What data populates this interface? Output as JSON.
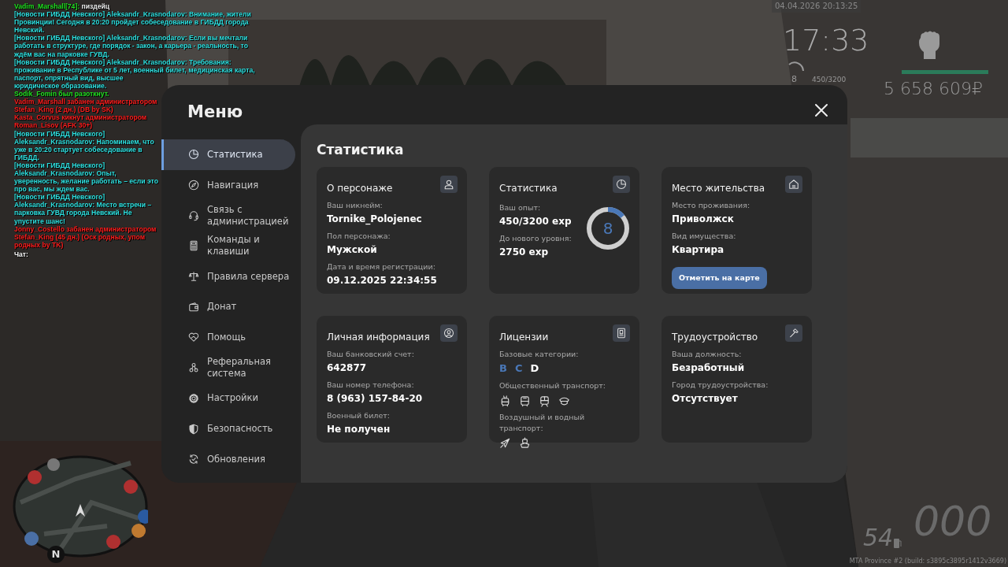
{
  "chat": [
    {
      "kind": "player",
      "name": "Vadim_Marshall[74]:",
      "text": "пиздейц"
    },
    {
      "kind": "news",
      "text": "[Новости ГИБДД Невского] Aleksandr_Krasnodarov: Внимание, жители Провинции! Сегодня в 20:20 пройдет собеседование в ГИБДД города Невский."
    },
    {
      "kind": "news",
      "text": "[Новости ГИБДД Невского] Aleksandr_Krasnodarov: Если вы мечтали работать в структуре, где порядок - закон, а карьера - реальность, то ждём вас на парковке ГУВД."
    },
    {
      "kind": "news",
      "text": "[Новости ГИБДД Невского] Aleksandr_Krasnodarov: Требования: проживание в Республике от 5 лет, военный билет, медицинская карта, паспорт, опрятный вид, высшее юридическое образование."
    },
    {
      "kind": "system",
      "text": "Sodik_Fomin был разоткнут."
    },
    {
      "kind": "ban",
      "text": "Vadim_Marshall забанен администратором Stefan_King (2 дн.) (DB by SK)"
    },
    {
      "kind": "ban",
      "text": "Kasta_Corvus кикнут администратором Roman_Lisov (AFK 30+)"
    },
    {
      "kind": "news",
      "text": "[Новости ГИБДД Невского] Aleksandr_Krasnodarov: Напоминаем, что уже в 20:20 стартует собеседование в ГИБДД."
    },
    {
      "kind": "news",
      "text": "[Новости ГИБДД Невского] Aleksandr_Krasnodarov: Опыт, уверенность, желание работать – если это про вас, мы ждем вас."
    },
    {
      "kind": "news",
      "text": "[Новости ГИБДД Невского] Aleksandr_Krasnodarov: Место встречи – парковка ГУВД города Невский. Не упустите шанс!"
    },
    {
      "kind": "ban",
      "text": "Jonny_Costello забанен администратором Stefan_King (45 дн.) (Оск родных, упом родных by TK)"
    }
  ],
  "chat_prompt": "Чат:",
  "hud": {
    "date": "04.04.2026 20:13:25",
    "time": "17:33",
    "player_level": "8",
    "exp": "450/3200",
    "health": {
      "level": 1
    },
    "money": "5 658 609₽",
    "compass": "N",
    "speed": "54",
    "odometer": "000",
    "build": "MTA Province #2 (build: s3895c3895r1412v3669)"
  },
  "menu": {
    "title": "Меню",
    "items": [
      {
        "label": "Статистика",
        "selected": true
      },
      {
        "label": "Навигация",
        "selected": false
      },
      {
        "label": "Связь с администрацией",
        "selected": false
      },
      {
        "label": "Команды и клавиши",
        "selected": false
      },
      {
        "label": "Правила сервера",
        "selected": false
      },
      {
        "label": "Донат",
        "selected": false
      },
      {
        "label": "Помощь",
        "selected": false
      },
      {
        "label": "Реферальная система",
        "selected": false
      },
      {
        "label": "Настройки",
        "selected": false
      },
      {
        "label": "Безопасность",
        "selected": false
      },
      {
        "label": "Обновления",
        "selected": false
      }
    ],
    "content_title": "Статистика",
    "cards": [
      {
        "kind": "fields",
        "title": "О персонаже",
        "fields": [
          {
            "label": "Ваш никнейм:",
            "value": "Tornike_Polojenec"
          },
          {
            "label": "Пол персонажа:",
            "value": "Мужской"
          },
          {
            "label": "Дата и время регистрации:",
            "value": "09.12.2025 22:34:55"
          }
        ]
      },
      {
        "kind": "stats",
        "title": "Статистика",
        "fields": [
          {
            "label": "Ваш опыт:",
            "value": "450/3200 exp"
          },
          {
            "label": "До нового уровня:",
            "value": "2750 exp"
          }
        ],
        "ring": {
          "level": 0.14,
          "label": "8"
        }
      },
      {
        "kind": "fields",
        "title": "Место жительства",
        "fields": [
          {
            "label": "Место проживания:",
            "value": "Приволжск"
          },
          {
            "label": "Вид имущества:",
            "value": "Квартира"
          }
        ],
        "button": "Отметить на карте"
      },
      {
        "kind": "fields",
        "title": "Личная информация",
        "fields": [
          {
            "label": "Ваш банковский счет:",
            "value": "642877"
          },
          {
            "label": "Ваш номер телефона:",
            "value": "8 (963) 157-84-20"
          },
          {
            "label": "Военный билет:",
            "value": "Не получен"
          }
        ]
      },
      {
        "kind": "licenses",
        "title": "Лицензии",
        "groups": [
          {
            "kind": "letters",
            "label": "Базовые категории:",
            "items": [
              {
                "label": "B",
                "owned": true
              },
              {
                "label": "C",
                "owned": true
              },
              {
                "label": "D",
                "owned": false
              }
            ]
          },
          {
            "kind": "icons",
            "label": "Общественный транспорт:"
          },
          {
            "kind": "icons",
            "label": "Воздушный и водный транспорт:"
          }
        ]
      },
      {
        "kind": "fields",
        "title": "Трудоустройство",
        "fields": [
          {
            "label": "Ваша должность:",
            "value": "Безработный"
          },
          {
            "label": "Город трудоустройства:",
            "value": "Отсутствует"
          }
        ]
      }
    ]
  }
}
